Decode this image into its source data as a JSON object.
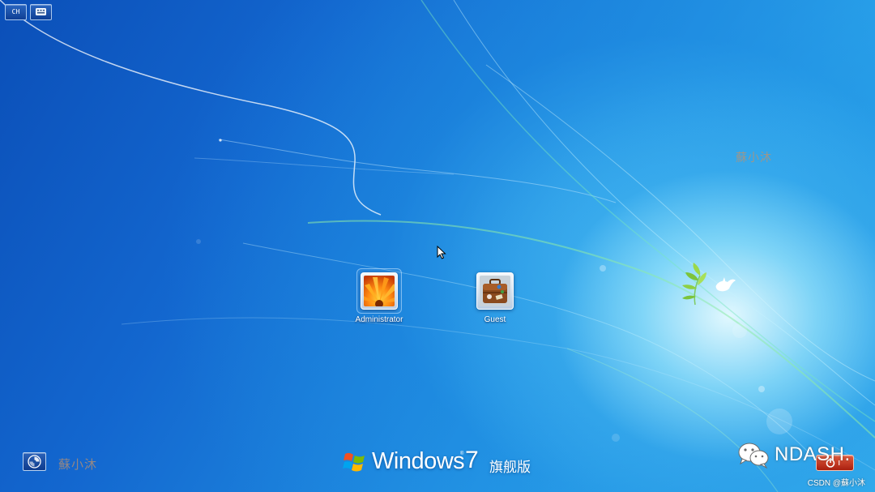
{
  "top_bar": {
    "ime_label": "CH",
    "keyboard_icon": "keyboard-icon"
  },
  "users": [
    {
      "name": "Administrator",
      "picture": "orange-flower-picture"
    },
    {
      "name": "Guest",
      "picture": "briefcase-picture"
    }
  ],
  "branding": {
    "windows_text": "Windows",
    "version": "7",
    "edition": "旗舰版"
  },
  "watermarks": {
    "center_right": "蘇小沐",
    "bottom_left": "蘇小沐",
    "wechat_text": "NDASH.",
    "csdn_credit": "CSDN @蘇小沐"
  },
  "controls": {
    "ease_of_access_icon": "ease-of-access-icon",
    "shutdown_icon": "power-icon"
  },
  "colors": {
    "background_dark": "#0b4fb8",
    "background_light": "#36b7f0",
    "shutdown_red": "#c8301c"
  }
}
